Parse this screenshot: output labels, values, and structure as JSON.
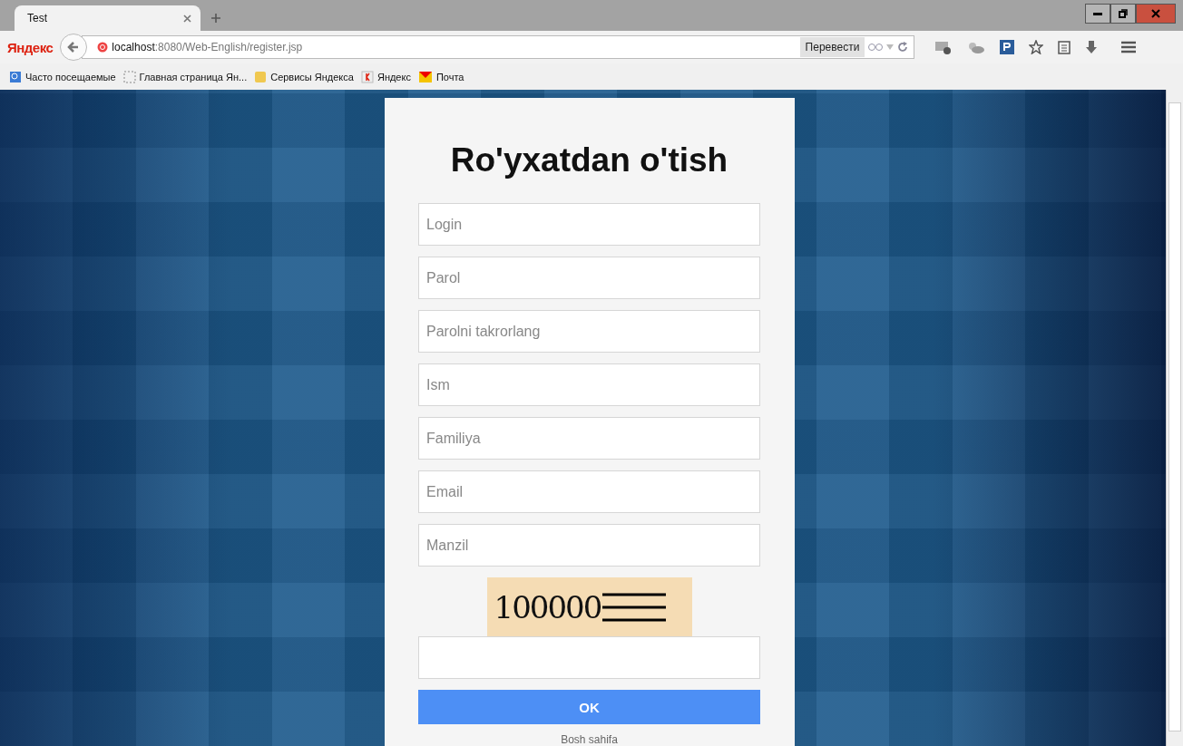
{
  "tabs": [
    {
      "title": "Test",
      "selected": true
    }
  ],
  "toolbar": {
    "logo": "Яндекс",
    "url_host": "localhost",
    "url_rest": ":8080/Web-English/register.jsp",
    "translate_button": "Перевести"
  },
  "bookmarks": [
    {
      "label": "Часто посещаемые",
      "kind": "search"
    },
    {
      "label": "Главная страница Ян...",
      "kind": "blank"
    },
    {
      "label": "Сервисы Яндекса",
      "kind": "folder"
    },
    {
      "label": "Яндекс",
      "kind": "yandex"
    },
    {
      "label": "Почта",
      "kind": "mail"
    }
  ],
  "form": {
    "title": "Ro'yxatdan o'tish",
    "fields": [
      {
        "placeholder": "Login"
      },
      {
        "placeholder": "Parol"
      },
      {
        "placeholder": "Parolni takrorlang"
      },
      {
        "placeholder": "Ism"
      },
      {
        "placeholder": "Familiya"
      },
      {
        "placeholder": "Email"
      },
      {
        "placeholder": "Manzil"
      }
    ],
    "captcha": "100000",
    "submit": "OK",
    "home_link": "Bosh sahifa"
  }
}
